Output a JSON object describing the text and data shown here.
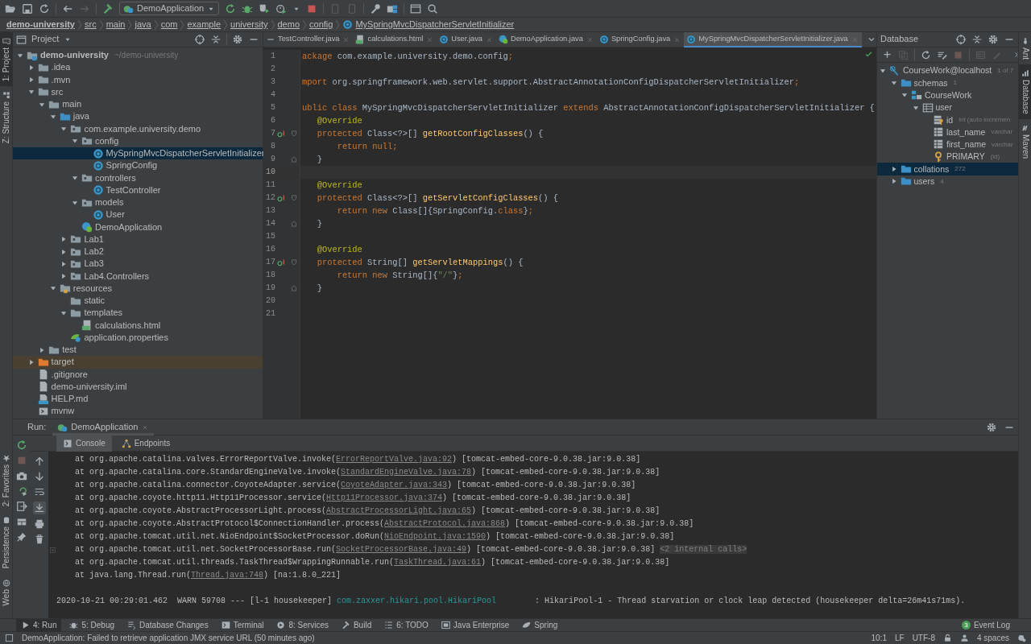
{
  "toolbar": {
    "run_config": "DemoApplication"
  },
  "breadcrumbs": [
    {
      "label": "demo-university",
      "kind": "project"
    },
    {
      "label": "src",
      "kind": "dir"
    },
    {
      "label": "main",
      "kind": "dir"
    },
    {
      "label": "java",
      "kind": "dir"
    },
    {
      "label": "com",
      "kind": "dir"
    },
    {
      "label": "example",
      "kind": "dir"
    },
    {
      "label": "university",
      "kind": "dir"
    },
    {
      "label": "demo",
      "kind": "dir"
    },
    {
      "label": "config",
      "kind": "dir"
    },
    {
      "label": "MySpringMvcDispatcherServletInitializer",
      "kind": "class"
    }
  ],
  "left_stripe": {
    "top": [
      {
        "label": "1: Project",
        "selected": true
      },
      {
        "label": "Z: Structure",
        "selected": false
      }
    ],
    "bottom": [
      {
        "label": "2: Favorites",
        "selected": false
      },
      {
        "label": "Persistence",
        "selected": false
      },
      {
        "label": "Web",
        "selected": false
      }
    ]
  },
  "right_stripe": [
    {
      "label": "Ant",
      "selected": false
    },
    {
      "label": "Database",
      "selected": true
    },
    {
      "label": "Maven",
      "selected": false
    }
  ],
  "project": {
    "title": "Project",
    "tree": [
      {
        "label": "demo-university",
        "detail": "~/demo-university",
        "kind": "module",
        "expanded": true,
        "selected": false,
        "children": [
          {
            "label": ".idea",
            "kind": "folder",
            "expanded": false,
            "selected": false
          },
          {
            "label": ".mvn",
            "kind": "folder",
            "expanded": false,
            "selected": false
          },
          {
            "label": "src",
            "kind": "folder",
            "expanded": true,
            "selected": false,
            "children": [
              {
                "label": "main",
                "kind": "folder",
                "expanded": true,
                "selected": false,
                "children": [
                  {
                    "label": "java",
                    "kind": "source-folder",
                    "expanded": true,
                    "selected": false,
                    "children": [
                      {
                        "label": "com.example.university.demo",
                        "kind": "package",
                        "expanded": true,
                        "selected": false,
                        "children": [
                          {
                            "label": "config",
                            "kind": "package",
                            "expanded": true,
                            "selected": false,
                            "children": [
                              {
                                "label": "MySpringMvcDispatcherServletInitializer",
                                "kind": "class",
                                "selected": true
                              },
                              {
                                "label": "SpringConfig",
                                "kind": "class",
                                "selected": false
                              }
                            ]
                          },
                          {
                            "label": "controllers",
                            "kind": "package",
                            "expanded": true,
                            "selected": false,
                            "children": [
                              {
                                "label": "TestController",
                                "kind": "class",
                                "selected": false
                              }
                            ]
                          },
                          {
                            "label": "models",
                            "kind": "package",
                            "expanded": true,
                            "selected": false,
                            "children": [
                              {
                                "label": "User",
                                "kind": "class",
                                "selected": false
                              }
                            ]
                          },
                          {
                            "label": "DemoApplication",
                            "kind": "spring-class",
                            "selected": false
                          }
                        ]
                      },
                      {
                        "label": "Lab1",
                        "kind": "package",
                        "expanded": false,
                        "selected": false
                      },
                      {
                        "label": "Lab2",
                        "kind": "package",
                        "expanded": false,
                        "selected": false
                      },
                      {
                        "label": "Lab3",
                        "kind": "package",
                        "expanded": false,
                        "selected": false
                      },
                      {
                        "label": "Lab4.Controllers",
                        "kind": "package",
                        "expanded": false,
                        "selected": false
                      }
                    ]
                  },
                  {
                    "label": "resources",
                    "kind": "resources-folder",
                    "expanded": true,
                    "selected": false,
                    "children": [
                      {
                        "label": "static",
                        "kind": "folder",
                        "selected": false
                      },
                      {
                        "label": "templates",
                        "kind": "folder",
                        "expanded": true,
                        "selected": false,
                        "children": [
                          {
                            "label": "calculations.html",
                            "kind": "html",
                            "selected": false
                          }
                        ]
                      },
                      {
                        "label": "application.properties",
                        "kind": "properties",
                        "selected": false
                      }
                    ]
                  }
                ]
              },
              {
                "label": "test",
                "kind": "folder",
                "expanded": false,
                "selected": false
              }
            ]
          },
          {
            "label": "target",
            "kind": "excluded-folder",
            "expanded": false,
            "selected": false
          },
          {
            "label": ".gitignore",
            "kind": "file",
            "selected": false
          },
          {
            "label": "demo-university.iml",
            "kind": "file",
            "selected": false
          },
          {
            "label": "HELP.md",
            "kind": "markdown",
            "selected": false
          },
          {
            "label": "mvnw",
            "kind": "script",
            "selected": false
          }
        ]
      }
    ]
  },
  "editor": {
    "tabs": [
      {
        "label": "TestController.java",
        "kind": "plain",
        "selected": false
      },
      {
        "label": "calculations.html",
        "kind": "html",
        "selected": false
      },
      {
        "label": "User.java",
        "kind": "class",
        "selected": false
      },
      {
        "label": "DemoApplication.java",
        "kind": "spring-class",
        "selected": false
      },
      {
        "label": "SpringConfig.java",
        "kind": "class",
        "selected": false
      },
      {
        "label": "MySpringMvcDispatcherServletInitializer.java",
        "kind": "class",
        "selected": true
      }
    ],
    "lines": [
      {
        "number": "1",
        "override": false,
        "fold_open": false,
        "fold_close": false,
        "current": false,
        "tokens": [
          {
            "text": "ackage",
            "kind": "keyword"
          },
          {
            "text": " com.example.university.demo.config",
            "kind": "plain"
          },
          {
            "text": ";",
            "kind": "keyword"
          }
        ]
      },
      {
        "number": "2",
        "override": false,
        "fold_open": false,
        "fold_close": false,
        "current": false
      },
      {
        "number": "3",
        "override": false,
        "fold_open": false,
        "fold_close": false,
        "current": false,
        "tokens": [
          {
            "text": "mport",
            "kind": "keyword"
          },
          {
            "text": " org.springframework.web.servlet.support.AbstractAnnotationConfigDispatcherServletInitializer",
            "kind": "plain"
          },
          {
            "text": ";",
            "kind": "keyword"
          }
        ]
      },
      {
        "number": "4",
        "override": false,
        "fold_open": false,
        "fold_close": false,
        "current": false
      },
      {
        "number": "5",
        "override": false,
        "fold_open": false,
        "fold_close": false,
        "current": false,
        "tokens": [
          {
            "text": "ublic class",
            "kind": "keyword"
          },
          {
            "text": " MySpringMvcDispatcherServletInitializer ",
            "kind": "plain"
          },
          {
            "text": "extends",
            "kind": "keyword"
          },
          {
            "text": " AbstractAnnotationConfigDispatcherServletInitializer {",
            "kind": "plain"
          }
        ]
      },
      {
        "number": "6",
        "override": false,
        "fold_open": false,
        "fold_close": false,
        "current": false,
        "tokens": [
          {
            "text": "   @Override",
            "kind": "annotation"
          }
        ]
      },
      {
        "number": "7",
        "override": true,
        "fold_open": true,
        "fold_close": false,
        "current": false,
        "tokens": [
          {
            "text": "   protected",
            "kind": "keyword"
          },
          {
            "text": " Class<?>[] ",
            "kind": "plain"
          },
          {
            "text": "getRootConfigClasses",
            "kind": "method"
          },
          {
            "text": "() {",
            "kind": "plain"
          }
        ]
      },
      {
        "number": "8",
        "override": false,
        "fold_open": false,
        "fold_close": false,
        "current": false,
        "tokens": [
          {
            "text": "       return null",
            "kind": "keyword"
          },
          {
            "text": ";",
            "kind": "keyword"
          }
        ]
      },
      {
        "number": "9",
        "override": false,
        "fold_open": false,
        "fold_close": true,
        "current": false,
        "tokens": [
          {
            "text": "   }",
            "kind": "plain"
          }
        ]
      },
      {
        "number": "10",
        "override": false,
        "fold_open": false,
        "fold_close": false,
        "current": true
      },
      {
        "number": "11",
        "override": false,
        "fold_open": false,
        "fold_close": false,
        "current": false,
        "tokens": [
          {
            "text": "   @Override",
            "kind": "annotation"
          }
        ]
      },
      {
        "number": "12",
        "override": true,
        "fold_open": true,
        "fold_close": false,
        "current": false,
        "tokens": [
          {
            "text": "   protected",
            "kind": "keyword"
          },
          {
            "text": " Class<?>[] ",
            "kind": "plain"
          },
          {
            "text": "getServletConfigClasses",
            "kind": "method"
          },
          {
            "text": "() {",
            "kind": "plain"
          }
        ]
      },
      {
        "number": "13",
        "override": false,
        "fold_open": false,
        "fold_close": false,
        "current": false,
        "tokens": [
          {
            "text": "       return new",
            "kind": "keyword"
          },
          {
            "text": " Class[]{SpringConfig.",
            "kind": "plain"
          },
          {
            "text": "class",
            "kind": "keyword"
          },
          {
            "text": "}",
            "kind": "plain"
          },
          {
            "text": ";",
            "kind": "keyword"
          }
        ]
      },
      {
        "number": "14",
        "override": false,
        "fold_open": false,
        "fold_close": true,
        "current": false,
        "tokens": [
          {
            "text": "   }",
            "kind": "plain"
          }
        ]
      },
      {
        "number": "15",
        "override": false,
        "fold_open": false,
        "fold_close": false,
        "current": false
      },
      {
        "number": "16",
        "override": false,
        "fold_open": false,
        "fold_close": false,
        "current": false,
        "tokens": [
          {
            "text": "   @Override",
            "kind": "annotation"
          }
        ]
      },
      {
        "number": "17",
        "override": true,
        "fold_open": true,
        "fold_close": false,
        "current": false,
        "tokens": [
          {
            "text": "   protected",
            "kind": "keyword"
          },
          {
            "text": " String[] ",
            "kind": "plain"
          },
          {
            "text": "getServletMappings",
            "kind": "method"
          },
          {
            "text": "() {",
            "kind": "plain"
          }
        ]
      },
      {
        "number": "18",
        "override": false,
        "fold_open": false,
        "fold_close": false,
        "current": false,
        "tokens": [
          {
            "text": "       return new",
            "kind": "keyword"
          },
          {
            "text": " String[]{",
            "kind": "plain"
          },
          {
            "text": "\"/\"",
            "kind": "string"
          },
          {
            "text": "}",
            "kind": "plain"
          },
          {
            "text": ";",
            "kind": "keyword"
          }
        ]
      },
      {
        "number": "19",
        "override": false,
        "fold_open": false,
        "fold_close": true,
        "current": false,
        "tokens": [
          {
            "text": "   }",
            "kind": "plain"
          }
        ]
      },
      {
        "number": "20",
        "override": false,
        "fold_open": false,
        "fold_close": false,
        "current": false
      },
      {
        "number": "21",
        "override": false,
        "fold_open": false,
        "fold_close": false,
        "current": false
      }
    ]
  },
  "database": {
    "title": "Database",
    "tree": [
      {
        "label": "CourseWork@localhost",
        "detail": "1 of 7",
        "kind": "datasource",
        "expanded": true,
        "selected": false,
        "children": [
          {
            "label": "schemas",
            "detail": "1",
            "kind": "db-folder",
            "expanded": true,
            "selected": false,
            "children": [
              {
                "label": "CourseWork",
                "kind": "schema",
                "expanded": true,
                "selected": false,
                "children": [
                  {
                    "label": "user",
                    "kind": "table",
                    "expanded": true,
                    "selected": false,
                    "children": [
                      {
                        "label": "id",
                        "detail": "int (auto incremen",
                        "kind": "key-column",
                        "selected": false
                      },
                      {
                        "label": "last_name",
                        "detail": "varchar",
                        "kind": "column",
                        "selected": false
                      },
                      {
                        "label": "first_name",
                        "detail": "varchar",
                        "kind": "column",
                        "selected": false
                      },
                      {
                        "label": "PRIMARY",
                        "detail": "(id)",
                        "kind": "index",
                        "selected": false
                      }
                    ]
                  }
                ]
              }
            ]
          },
          {
            "label": "collations",
            "detail": "272",
            "kind": "db-folder",
            "expanded": false,
            "selected": true
          },
          {
            "label": "users",
            "detail": "4",
            "kind": "db-folder",
            "expanded": false,
            "selected": false
          }
        ]
      }
    ]
  },
  "run": {
    "label": "Run:",
    "tabs": [
      {
        "label": "DemoApplication",
        "selected": true
      }
    ],
    "console_tabs": [
      {
        "label": "Console",
        "kind": "console",
        "selected": true
      },
      {
        "label": "Endpoints",
        "kind": "endpoints",
        "selected": false
      }
    ],
    "lines": [
      {
        "kind": "trace",
        "fold_marker": false,
        "segments": [
          {
            "text": "at org.apache.catalina.valves.ErrorReportValve.invoke(",
            "kind": "plain"
          },
          {
            "text": "ErrorReportValve.java:92",
            "kind": "link"
          },
          {
            "text": ") [tomcat-embed-core-9.0.38.jar:9.0.38]",
            "kind": "plain"
          }
        ]
      },
      {
        "kind": "trace",
        "fold_marker": false,
        "segments": [
          {
            "text": "at org.apache.catalina.core.StandardEngineValve.invoke(",
            "kind": "plain"
          },
          {
            "text": "StandardEngineValve.java:78",
            "kind": "link"
          },
          {
            "text": ") [tomcat-embed-core-9.0.38.jar:9.0.38]",
            "kind": "plain"
          }
        ]
      },
      {
        "kind": "trace",
        "fold_marker": false,
        "segments": [
          {
            "text": "at org.apache.catalina.connector.CoyoteAdapter.service(",
            "kind": "plain"
          },
          {
            "text": "CoyoteAdapter.java:343",
            "kind": "link"
          },
          {
            "text": ") [tomcat-embed-core-9.0.38.jar:9.0.38]",
            "kind": "plain"
          }
        ]
      },
      {
        "kind": "trace",
        "fold_marker": false,
        "segments": [
          {
            "text": "at org.apache.coyote.http11.Http11Processor.service(",
            "kind": "plain"
          },
          {
            "text": "Http11Processor.java:374",
            "kind": "link"
          },
          {
            "text": ") [tomcat-embed-core-9.0.38.jar:9.0.38]",
            "kind": "plain"
          }
        ]
      },
      {
        "kind": "trace",
        "fold_marker": false,
        "segments": [
          {
            "text": "at org.apache.coyote.AbstractProcessorLight.process(",
            "kind": "plain"
          },
          {
            "text": "AbstractProcessorLight.java:65",
            "kind": "link"
          },
          {
            "text": ") [tomcat-embed-core-9.0.38.jar:9.0.38]",
            "kind": "plain"
          }
        ]
      },
      {
        "kind": "trace",
        "fold_marker": false,
        "segments": [
          {
            "text": "at org.apache.coyote.AbstractProtocol$ConnectionHandler.process(",
            "kind": "plain"
          },
          {
            "text": "AbstractProtocol.java:868",
            "kind": "link"
          },
          {
            "text": ") [tomcat-embed-core-9.0.38.jar:9.0.38]",
            "kind": "plain"
          }
        ]
      },
      {
        "kind": "trace",
        "fold_marker": false,
        "segments": [
          {
            "text": "at org.apache.tomcat.util.net.NioEndpoint$SocketProcessor.doRun(",
            "kind": "plain"
          },
          {
            "text": "NioEndpoint.java:1590",
            "kind": "link"
          },
          {
            "text": ") [tomcat-embed-core-9.0.38.jar:9.0.38]",
            "kind": "plain"
          }
        ]
      },
      {
        "kind": "trace",
        "fold_marker": true,
        "segments": [
          {
            "text": "at org.apache.tomcat.util.net.SocketProcessorBase.run(",
            "kind": "plain"
          },
          {
            "text": "SocketProcessorBase.java:49",
            "kind": "link"
          },
          {
            "text": ") [tomcat-embed-core-9.0.38.jar:9.0.38] ",
            "kind": "plain"
          },
          {
            "text": "<2 internal calls>",
            "kind": "hint"
          }
        ]
      },
      {
        "kind": "trace",
        "fold_marker": false,
        "segments": [
          {
            "text": "at org.apache.tomcat.util.threads.TaskThread$WrappingRunnable.run(",
            "kind": "plain"
          },
          {
            "text": "TaskThread.java:61",
            "kind": "link"
          },
          {
            "text": ") [tomcat-embed-core-9.0.38.jar:9.0.38]",
            "kind": "plain"
          }
        ]
      },
      {
        "kind": "trace",
        "fold_marker": false,
        "segments": [
          {
            "text": "at java.lang.Thread.run(",
            "kind": "plain"
          },
          {
            "text": "Thread.java:748",
            "kind": "link"
          },
          {
            "text": ") [na:1.8.0_221]",
            "kind": "plain"
          }
        ]
      },
      {
        "kind": "log",
        "fold_marker": false,
        "segments": [
          {
            "text": "2020-10-21 00:29:01.462  WARN 59708 --- [l-1 housekeeper] ",
            "kind": "plain"
          },
          {
            "text": "com.zaxxer.hikari.pool.HikariPool",
            "kind": "logger"
          },
          {
            "text": "        : HikariPool-1 - Thread starvation or clock leap detected (housekeeper delta=26m41s71ms).",
            "kind": "plain"
          }
        ]
      }
    ]
  },
  "tool_windows": [
    {
      "label": "4: Run",
      "kind": "run",
      "selected": true
    },
    {
      "label": "5: Debug",
      "kind": "debug",
      "selected": false
    },
    {
      "label": "Database Changes",
      "kind": "db-changes",
      "selected": false
    },
    {
      "label": "Terminal",
      "kind": "terminal",
      "selected": false
    },
    {
      "label": "8: Services",
      "kind": "services",
      "selected": false
    },
    {
      "label": "Build",
      "kind": "build",
      "selected": false
    },
    {
      "label": "6: TODO",
      "kind": "todo",
      "selected": false
    },
    {
      "label": "Java Enterprise",
      "kind": "javaee",
      "selected": false
    },
    {
      "label": "Spring",
      "kind": "spring",
      "selected": false
    }
  ],
  "event_log": {
    "label": "Event Log",
    "count": "3"
  },
  "status_bar": {
    "message": "DemoApplication: Failed to retrieve application JMX service URL (50 minutes ago)",
    "position": "10:1",
    "line_separator": "LF",
    "encoding": "UTF-8",
    "indent": "4 spaces"
  }
}
